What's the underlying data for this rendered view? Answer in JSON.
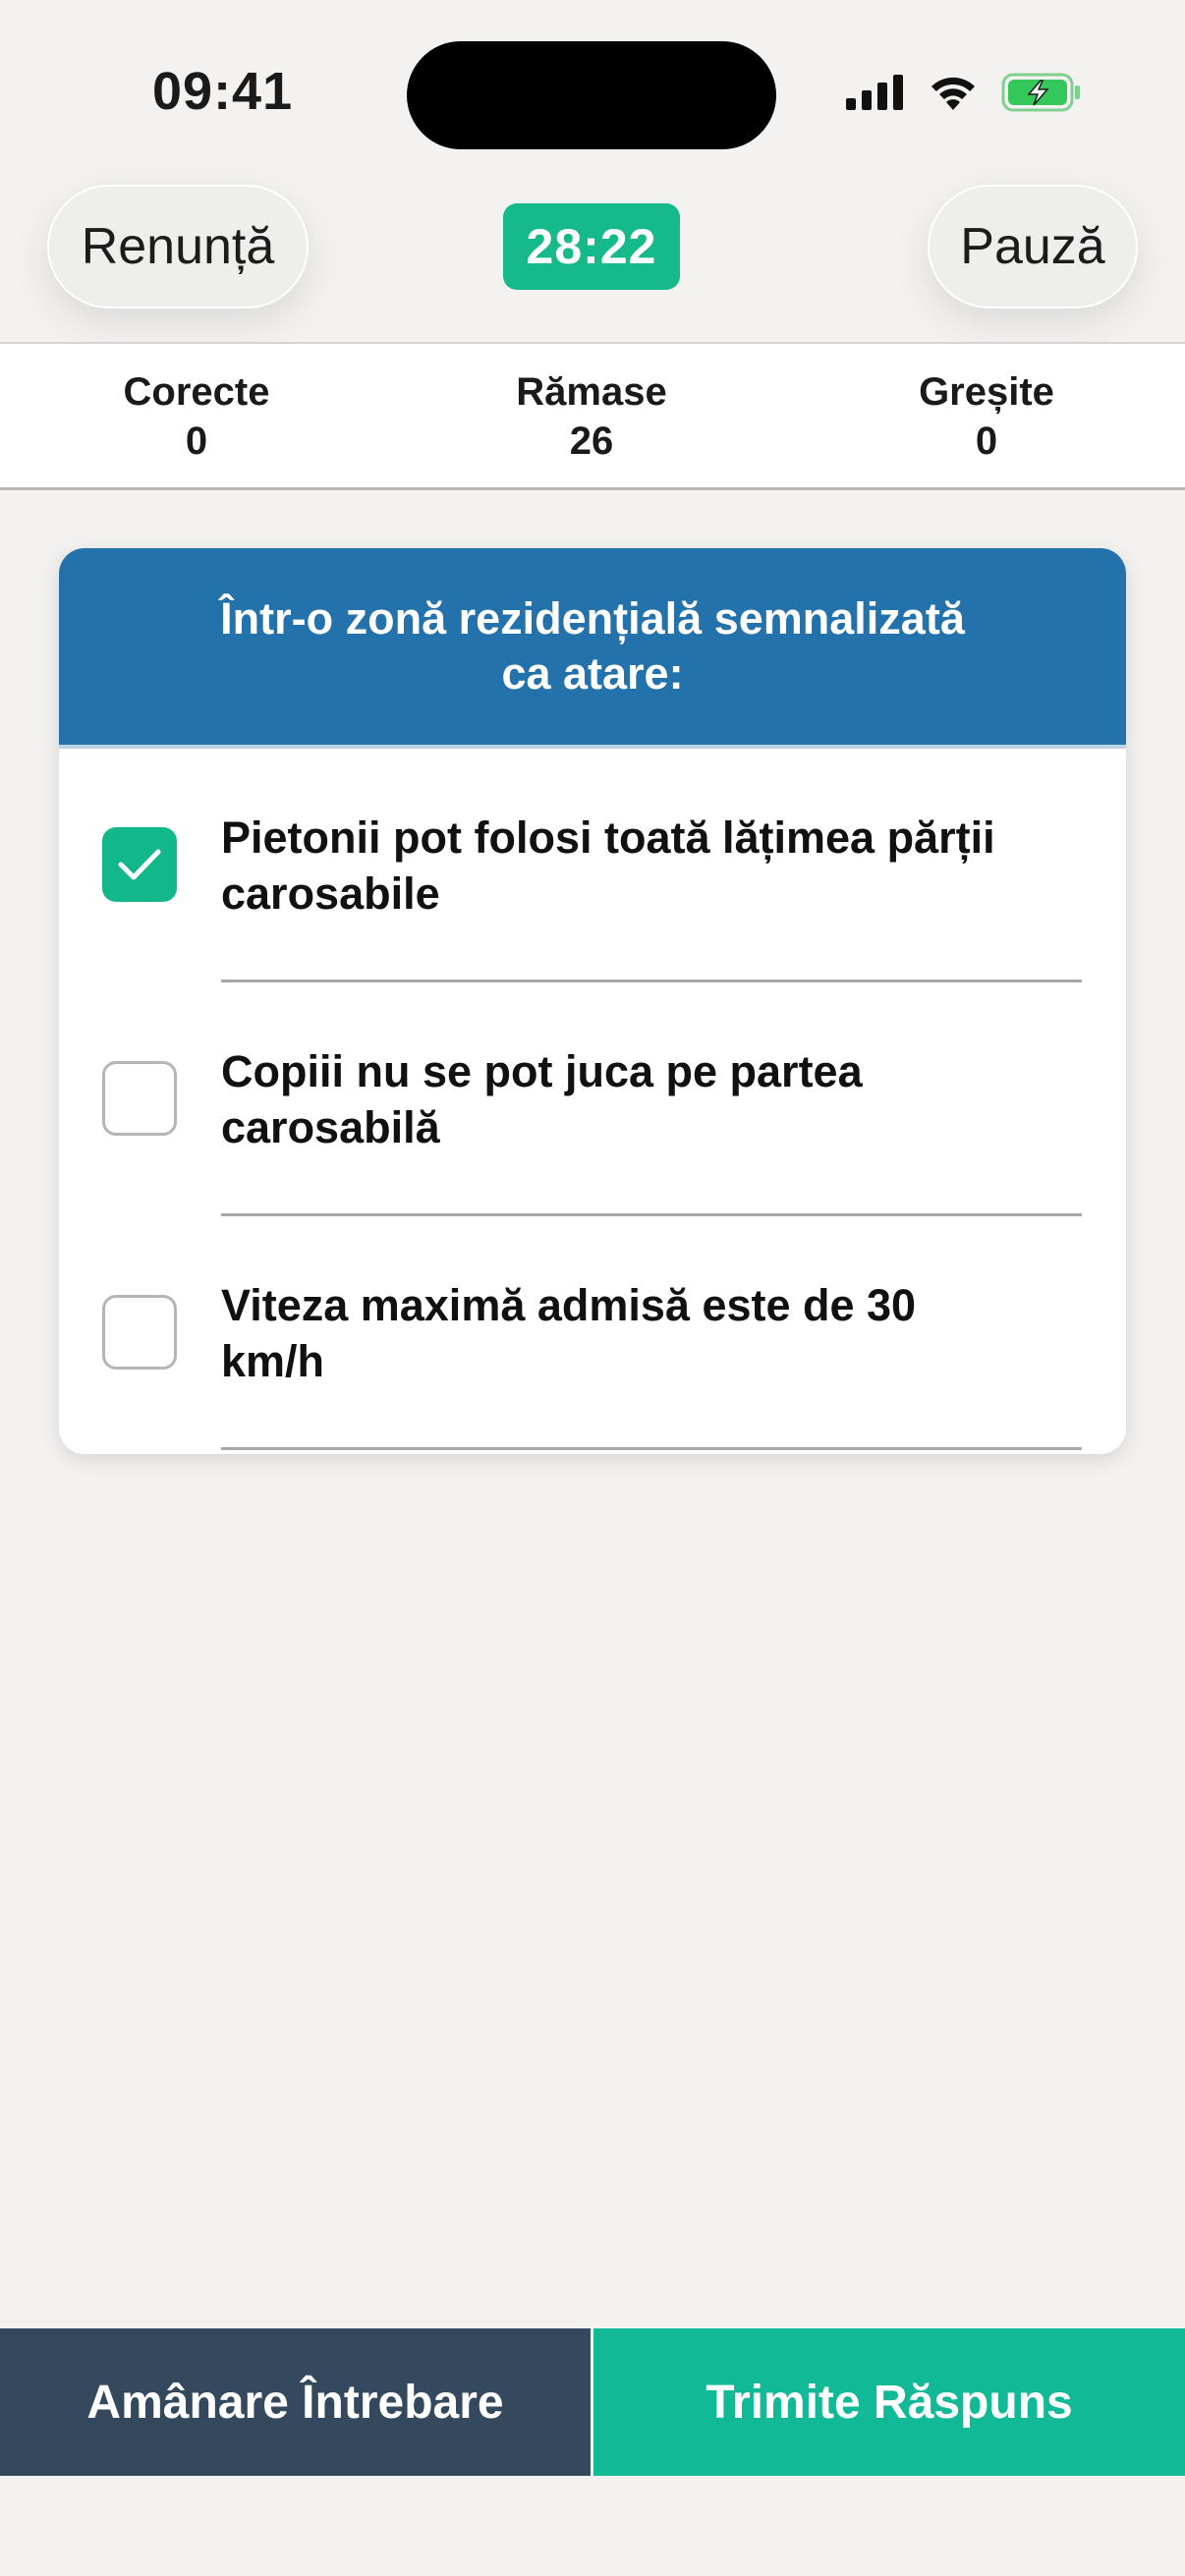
{
  "status_bar": {
    "time": "09:41",
    "icons": [
      "cellular-signal-icon",
      "wifi-icon",
      "battery-charging-icon"
    ]
  },
  "nav": {
    "cancel_label": "Renunță",
    "timer": "28:22",
    "pause_label": "Pauză"
  },
  "stats": {
    "correct_label": "Corecte",
    "correct_value": "0",
    "remaining_label": "Rămase",
    "remaining_value": "26",
    "wrong_label": "Greșite",
    "wrong_value": "0"
  },
  "question": {
    "text": "Într-o zonă rezidențială semnalizată ca atare:",
    "answers": [
      {
        "text": "Pietonii pot folosi toată lățimea părții carosabile",
        "checked": true
      },
      {
        "text": "Copiii nu se pot juca pe partea carosabilă",
        "checked": false
      },
      {
        "text": "Viteza maximă admisă este de 30 km/h",
        "checked": false
      }
    ]
  },
  "actions": {
    "postpone_label": "Amânare Întrebare",
    "submit_label": "Trimite Răspuns"
  },
  "colors": {
    "accent": "#15b98a",
    "header_blue": "#2472ab",
    "postpone_bg": "#34485e",
    "background": "#f3f2f1"
  }
}
